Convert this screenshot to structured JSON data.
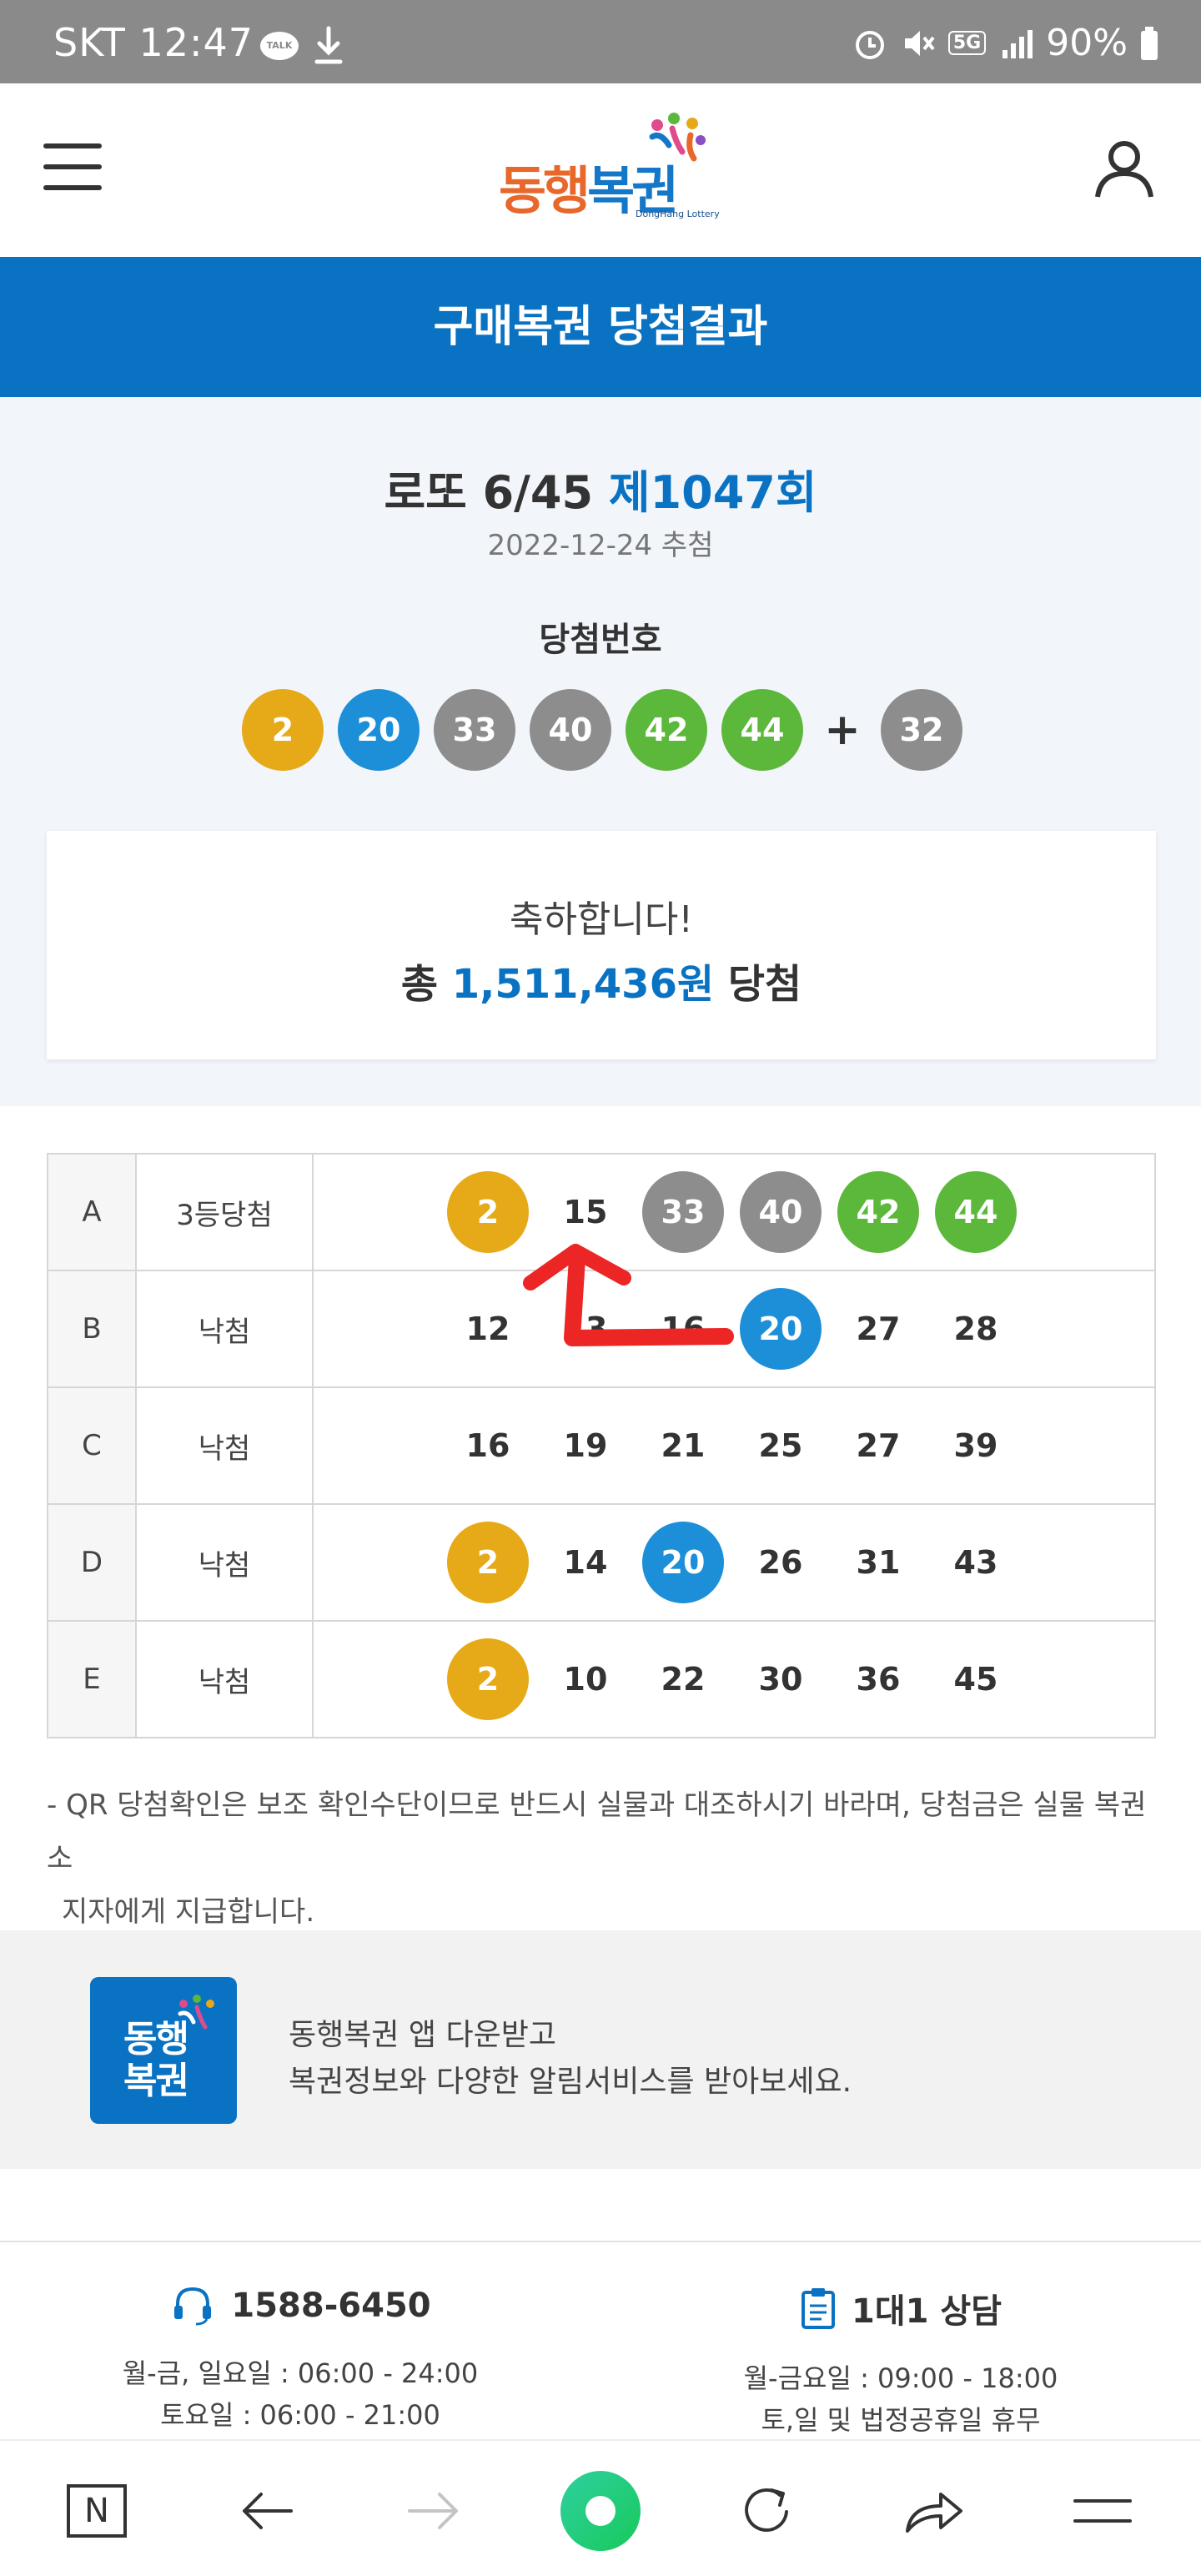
{
  "status_bar": {
    "carrier_time": "SKT 12:47",
    "talk_badge": "TALK",
    "network": "5G",
    "battery": "90%"
  },
  "header": {
    "logo_text_1": "동행",
    "logo_text_2": "복권",
    "logo_sub": "DongHang Lottery",
    "menu_icon": "hamburger-menu-icon",
    "user_icon": "user-profile-icon"
  },
  "banner": {
    "title": "구매복권 당첨결과"
  },
  "result": {
    "game": "로또 6/45",
    "round": "제1047회",
    "draw_date": "2022-12-24 추첨",
    "win_label": "당첨번호",
    "winning_numbers": [
      "2",
      "20",
      "33",
      "40",
      "42",
      "44"
    ],
    "plus": "+",
    "bonus_number": "32"
  },
  "congrats": {
    "line1": "축하합니다!",
    "prefix": "총",
    "amount": "1,511,436원",
    "suffix": "당첨"
  },
  "ticket": {
    "rows": [
      {
        "game": "A",
        "result": "3등당첨",
        "numbers": [
          "2",
          "15",
          "33",
          "40",
          "42",
          "44"
        ]
      },
      {
        "game": "B",
        "result": "낙첨",
        "numbers": [
          "12",
          "13",
          "16",
          "20",
          "27",
          "28"
        ]
      },
      {
        "game": "C",
        "result": "낙첨",
        "numbers": [
          "16",
          "19",
          "21",
          "25",
          "27",
          "39"
        ]
      },
      {
        "game": "D",
        "result": "낙첨",
        "numbers": [
          "2",
          "14",
          "20",
          "26",
          "31",
          "43"
        ]
      },
      {
        "game": "E",
        "result": "낙첨",
        "numbers": [
          "2",
          "10",
          "22",
          "30",
          "36",
          "45"
        ]
      }
    ]
  },
  "notice": {
    "line1": "- QR 당첨확인은 보조 확인수단이므로 반드시 실물과 대조하시기 바라며, 당첨금은 실물 복권소",
    "line2": "지자에게 지급합니다."
  },
  "app_promo": {
    "icon_line1": "동행",
    "icon_line2": "복권",
    "line1": "동행복권 앱 다운받고",
    "line2": "복권정보와 다양한 알림서비스를 받아보세요."
  },
  "contacts": {
    "phone": {
      "label": "1588-6450",
      "hours1": "월-금, 일요일 : 06:00 - 24:00",
      "hours2": "토요일 : 06:00 - 21:00"
    },
    "chat": {
      "label": "1대1 상담",
      "hours1": "월-금요일 : 09:00 - 18:00",
      "hours2": "토,일 및 법정공휴일 휴무"
    }
  },
  "bottom_nav": {
    "home_label": "N"
  },
  "colors": {
    "blue": "#0a72c2",
    "ball_yellow": "#e6a917",
    "ball_blue": "#1c8fd8",
    "ball_gray": "#8d8d8d",
    "ball_green": "#5cb83a"
  }
}
